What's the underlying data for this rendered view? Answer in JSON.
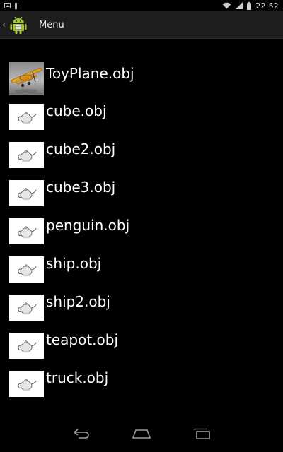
{
  "status_bar": {
    "time": "22:52",
    "icons": [
      "notification-icon",
      "barcode-icon",
      "wifi-icon",
      "signal-icon",
      "battery-icon"
    ]
  },
  "action_bar": {
    "title": "Menu",
    "icon": "android-app-icon"
  },
  "list": {
    "items": [
      {
        "label": "ToyPlane.obj",
        "thumbnail": "toy-plane-thumbnail"
      },
      {
        "label": "cube.obj",
        "thumbnail": "teapot-thumbnail"
      },
      {
        "label": "cube2.obj",
        "thumbnail": "teapot-thumbnail"
      },
      {
        "label": "cube3.obj",
        "thumbnail": "teapot-thumbnail"
      },
      {
        "label": "penguin.obj",
        "thumbnail": "teapot-thumbnail"
      },
      {
        "label": "ship.obj",
        "thumbnail": "teapot-thumbnail"
      },
      {
        "label": "ship2.obj",
        "thumbnail": "teapot-thumbnail"
      },
      {
        "label": "teapot.obj",
        "thumbnail": "teapot-thumbnail"
      },
      {
        "label": "truck.obj",
        "thumbnail": "teapot-thumbnail"
      }
    ]
  },
  "nav_bar": {
    "buttons": [
      "back-icon",
      "home-icon",
      "recents-icon"
    ]
  },
  "colors": {
    "background": "#000000",
    "action_bar": "#1e1e1e",
    "android_green": "#a4c639",
    "text": "#ffffff"
  }
}
